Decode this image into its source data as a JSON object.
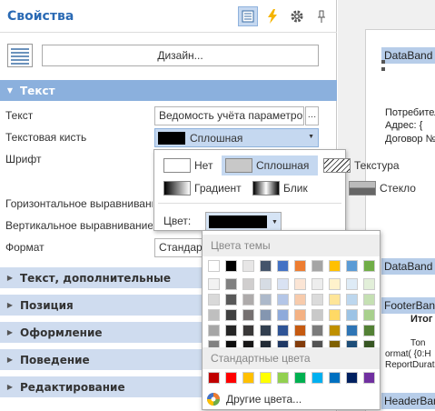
{
  "panel": {
    "title": "Свойства",
    "design_button": "Дизайн..."
  },
  "sections": {
    "text": "Текст",
    "text_extra": "Текст, дополнительные",
    "position": "Позиция",
    "appearance": "Оформление",
    "behavior": "Поведение",
    "editing": "Редактирование"
  },
  "properties": [
    {
      "label": "Текст",
      "value": "Ведомость учёта параметро"
    },
    {
      "label": "Текстовая кисть",
      "value": "Сплошная"
    },
    {
      "label": "Шрифт",
      "value": ""
    },
    {
      "label": "Горизонтальное выравнивание",
      "value": ""
    },
    {
      "label": "Вертикальное выравнивание",
      "value": ""
    },
    {
      "label": "Формат",
      "value": "Стандар"
    }
  ],
  "brush_dropdown": {
    "options": [
      {
        "label": "Нет"
      },
      {
        "label": "Сплошная"
      },
      {
        "label": "Текстура"
      },
      {
        "label": "Градиент"
      },
      {
        "label": "Блик"
      },
      {
        "label": "Стекло"
      }
    ],
    "color_label": "Цвет:",
    "current_color": "#000000"
  },
  "palette": {
    "theme_title": "Цвета темы",
    "standard_title": "Стандартные цвета",
    "more_colors": "Другие цвета...",
    "theme_top": [
      "#ffffff",
      "#000000",
      "#e7e6e6",
      "#44546a",
      "#4472c4",
      "#ed7d31",
      "#a5a5a5",
      "#ffc000",
      "#5b9bd5",
      "#70ad47"
    ],
    "theme_shades": [
      [
        "#f2f2f2",
        "#808080",
        "#d0cece",
        "#d6dce4",
        "#d9e2f3",
        "#fbe5d5",
        "#ededed",
        "#fff2cc",
        "#deebf6",
        "#e2efd9"
      ],
      [
        "#d9d9d9",
        "#595959",
        "#aeabab",
        "#adb9ca",
        "#b4c6e7",
        "#f7cbac",
        "#dbdbdb",
        "#fee599",
        "#bdd7ee",
        "#c5e0b3"
      ],
      [
        "#bfbfbf",
        "#404040",
        "#757070",
        "#8496b0",
        "#8eaadb",
        "#f4b183",
        "#c9c9c9",
        "#ffd965",
        "#9cc3e5",
        "#a8d08d"
      ],
      [
        "#a6a6a6",
        "#262626",
        "#3a3838",
        "#323f4f",
        "#2f5496",
        "#c55a11",
        "#7b7b7b",
        "#bf9000",
        "#2e75b5",
        "#538135"
      ],
      [
        "#808080",
        "#0d0d0d",
        "#171616",
        "#222a35",
        "#1f3864",
        "#833c0b",
        "#525252",
        "#7f6000",
        "#1e4e79",
        "#375623"
      ]
    ],
    "standard": [
      "#c00000",
      "#ff0000",
      "#ffc000",
      "#ffff00",
      "#92d050",
      "#00b050",
      "#00b0f0",
      "#0070c0",
      "#002060",
      "#7030a0"
    ]
  },
  "report": {
    "band1": "DataBand",
    "lines": [
      "Потребител",
      "Адрес: {",
      "Договор №"
    ],
    "band2": "DataBand",
    "band3": "FooterBan",
    "footer_text": "Итог",
    "fragments": [
      "Тоn",
      "ormat( {0:H",
      "ReportDurati"
    ],
    "band4": "HeaderBan"
  }
}
